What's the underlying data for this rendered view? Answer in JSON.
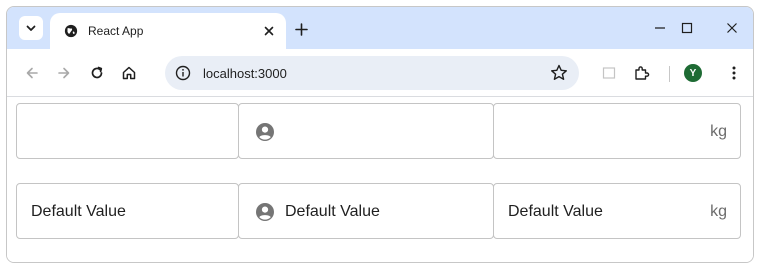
{
  "browser": {
    "tab": {
      "title": "React App"
    },
    "new_tab_symbol": "+",
    "window_controls": {
      "minimize": "–",
      "maximize": "☐",
      "close": "✕"
    },
    "address_bar": {
      "url": "localhost:3000"
    },
    "profile_initial": "Y",
    "icons": {
      "tab_search": "chevron-down-icon",
      "favicon": "globe-icon",
      "back": "arrow-left-icon",
      "forward": "arrow-right-icon",
      "reload": "reload-icon",
      "home": "home-icon",
      "site_info": "info-icon",
      "bookmark": "star-icon",
      "extensions": "puzzle-icon",
      "menu": "kebab-icon"
    }
  },
  "form": {
    "rows": [
      {
        "plain_value": "",
        "icon_value": "",
        "suffix_value": "",
        "suffix": "kg"
      },
      {
        "plain_value": "Default Value",
        "icon_value": "Default Value",
        "suffix_value": "Default Value",
        "suffix": "kg"
      }
    ],
    "field_icon": "account-circle-icon"
  },
  "colors": {
    "tabstrip_bg": "#d3e3fd",
    "omnibox_bg": "#e9eef6",
    "profile_bg": "#1e6b34",
    "field_border": "#c4c4c4",
    "icon_gray": "#757575"
  }
}
